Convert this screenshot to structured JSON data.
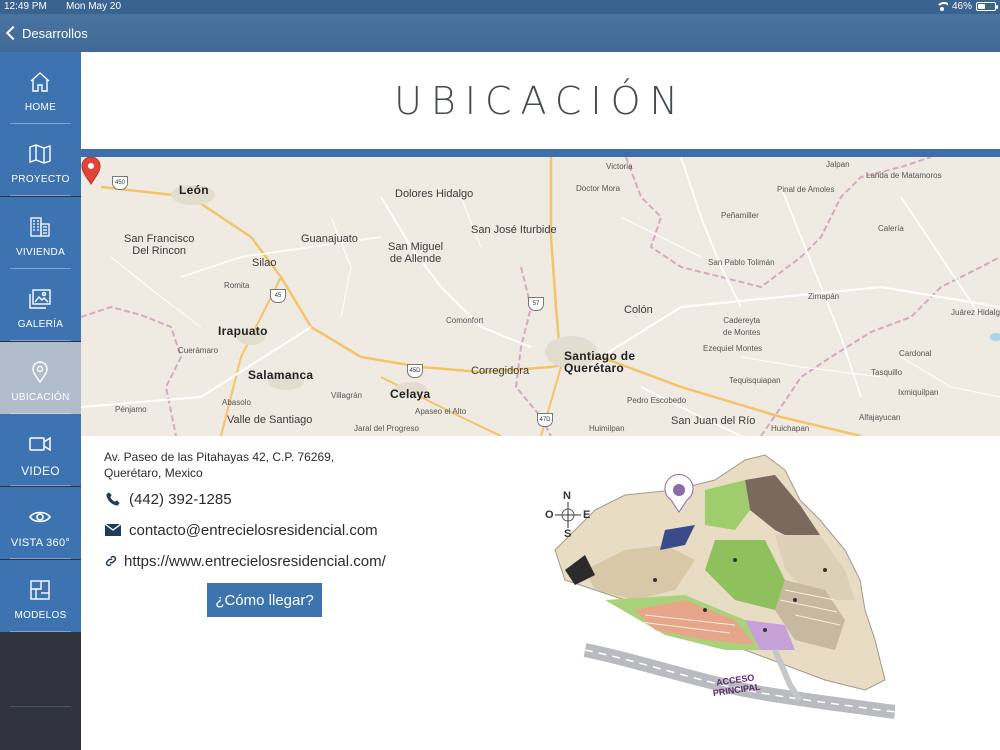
{
  "status_bar": {
    "time": "12:49 PM",
    "date": "Mon May 20",
    "battery": "46%",
    "battery_level": 0.46
  },
  "nav": {
    "back_label": "Desarrollos"
  },
  "sidebar": {
    "items": [
      {
        "label": "HOME",
        "icon": "home-icon"
      },
      {
        "label": "PROYECTO",
        "icon": "map-folded-icon"
      },
      {
        "label": "VIVIENDA",
        "icon": "building-icon"
      },
      {
        "label": "GALERÍA",
        "icon": "image-icon"
      },
      {
        "label": "UBICACIÓN",
        "icon": "location-pin-icon",
        "active": true
      },
      {
        "label": "VIDEO",
        "icon": "video-camera-icon"
      },
      {
        "label": "VISTA 360°",
        "icon": "eye-icon"
      },
      {
        "label": "MODELOS",
        "icon": "floorplan-icon"
      }
    ]
  },
  "main": {
    "title": "UBICACIÓN"
  },
  "map": {
    "cities": [
      {
        "name": "León",
        "size": "big"
      },
      {
        "name": "Dolores Hidalgo",
        "size": "normal"
      },
      {
        "name": "Doctor Mora",
        "size": "small"
      },
      {
        "name": "Victoria",
        "size": "small"
      },
      {
        "name": "Jalpan",
        "size": "small"
      },
      {
        "name": "Landa de Matamoros",
        "size": "small"
      },
      {
        "name": "Pinal de Amoles",
        "size": "small"
      },
      {
        "name": "Peñamiller",
        "size": "small"
      },
      {
        "name": "San José Iturbide",
        "size": "normal"
      },
      {
        "name": "San Francisco\nDel Rincon",
        "size": "normal"
      },
      {
        "name": "Guanajuato",
        "size": "normal"
      },
      {
        "name": "San Miguel\nde Allende",
        "size": "normal"
      },
      {
        "name": "Calería",
        "size": "small"
      },
      {
        "name": "San Pablo Tolimán",
        "size": "small"
      },
      {
        "name": "Silao",
        "size": "normal"
      },
      {
        "name": "Romita",
        "size": "small"
      },
      {
        "name": "Colón",
        "size": "normal"
      },
      {
        "name": "Cadereyta\nde Montes",
        "size": "small"
      },
      {
        "name": "Zimapán",
        "size": "small"
      },
      {
        "name": "Juárez Hidalgo",
        "size": "small"
      },
      {
        "name": "Irapuato",
        "size": "big"
      },
      {
        "name": "Comonfort",
        "size": "small"
      },
      {
        "name": "Cuerámaro",
        "size": "small"
      },
      {
        "name": "Santiago de\nQuerétaro",
        "size": "big"
      },
      {
        "name": "Ezequiel Montes",
        "size": "small"
      },
      {
        "name": "Cardonal",
        "size": "small"
      },
      {
        "name": "Salamanca",
        "size": "big"
      },
      {
        "name": "Corregidora",
        "size": "normal"
      },
      {
        "name": "Tequisquiapan",
        "size": "small"
      },
      {
        "name": "Tasquillo",
        "size": "small"
      },
      {
        "name": "Ixmiquilpan",
        "size": "small"
      },
      {
        "name": "Celaya",
        "size": "big"
      },
      {
        "name": "Villagrán",
        "size": "small"
      },
      {
        "name": "Abasolo",
        "size": "small"
      },
      {
        "name": "Pedro Escobedo",
        "size": "small"
      },
      {
        "name": "Pénjamo",
        "size": "small"
      },
      {
        "name": "Apaseo el Alto",
        "size": "small"
      },
      {
        "name": "Alfajayucan",
        "size": "small"
      },
      {
        "name": "Valle de Santiago",
        "size": "normal"
      },
      {
        "name": "San Juan del Río",
        "size": "normal"
      },
      {
        "name": "Jaral del Progreso",
        "size": "small"
      },
      {
        "name": "Huimilpan",
        "size": "small"
      },
      {
        "name": "Huichapan",
        "size": "small"
      }
    ],
    "highway_shields": [
      "450",
      "45",
      "57",
      "45D",
      "47D"
    ]
  },
  "contact": {
    "address_line1": "Av. Paseo de las Pitahayas 42, C.P. 76269,",
    "address_line2": "Querétaro, Mexico",
    "phone": "(442) 392-1285",
    "email": "contacto@entrecielosresidencial.com",
    "website": "https://www.entrecielosresidencial.com/",
    "directions_button": "¿Cómo llegar?"
  },
  "site_plan": {
    "compass": {
      "n": "N",
      "s": "S",
      "e": "E",
      "w": "O"
    },
    "access_label": "ACCESO\nPRINCIPAL"
  }
}
